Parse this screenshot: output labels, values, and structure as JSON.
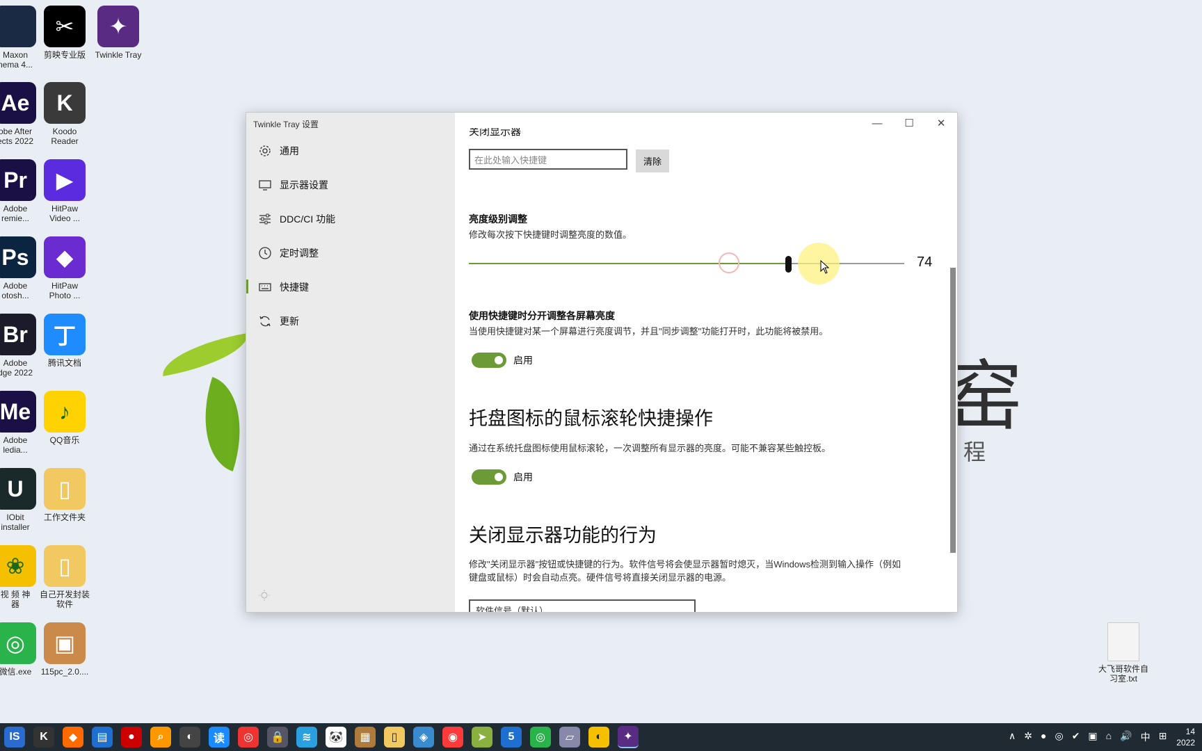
{
  "desktop": {
    "icons": [
      {
        "label": "Maxon\nnema 4...",
        "glyph": "",
        "color": "#1b2a44"
      },
      {
        "label": "剪映专业版",
        "glyph": "✂",
        "color": "#000000"
      },
      {
        "label": "Twinkle Tray",
        "glyph": "✦",
        "color": "#5a2b83"
      },
      {
        "label": "obe After\nects 2022",
        "glyph": "Ae",
        "color": "#1a1046"
      },
      {
        "label": "Koodo\nReader",
        "glyph": "K",
        "color": "#3a3a3a"
      },
      {
        "label": "Adobe\nremie...",
        "glyph": "Pr",
        "color": "#1a1046"
      },
      {
        "label": "HitPaw\nVideo ...",
        "glyph": "▶",
        "color": "#5b2be0"
      },
      {
        "label": "Adobe\notosh...",
        "glyph": "Ps",
        "color": "#0b2440"
      },
      {
        "label": "HitPaw\nPhoto ...",
        "glyph": "◆",
        "color": "#6a2bd0"
      },
      {
        "label": "Adobe\ndge 2022",
        "glyph": "Br",
        "color": "#1b1b2a"
      },
      {
        "label": "腾讯文档",
        "glyph": "丁",
        "color": "#1e8cff"
      },
      {
        "label": "Adobe\nledia...",
        "glyph": "Me",
        "color": "#1a1046"
      },
      {
        "label": "QQ音乐",
        "glyph": "♪",
        "color": "#ffd200"
      },
      {
        "label": "IObit\ninstaller",
        "glyph": "U",
        "color": "#1a2a2a"
      },
      {
        "label": "工作文件夹",
        "glyph": "▯",
        "color": "#f1c960"
      },
      {
        "label": "视 频 神\n器",
        "glyph": "❀",
        "color": "#f5c000"
      },
      {
        "label": "自己开发封装\n软件",
        "glyph": "▯",
        "color": "#f1c960"
      },
      {
        "label": "微信.exe",
        "glyph": "◎",
        "color": "#2ab34a"
      },
      {
        "label": "115pc_2.0....",
        "glyph": "▣",
        "color": "#c98a4a"
      },
      {
        "label": "大飞哥软件自\n习室.txt",
        "glyph": "",
        "color": "#f4f4f4"
      }
    ],
    "bg_text_1": "窑",
    "bg_text_2": "程"
  },
  "window": {
    "title": "Twinkle Tray 设置",
    "controls": {
      "minimize": "—",
      "maximize": "☐",
      "close": "✕"
    },
    "sidebar": {
      "items": [
        {
          "label": "通用",
          "icon": "gear-icon"
        },
        {
          "label": "显示器设置",
          "icon": "monitor-icon"
        },
        {
          "label": "DDC/CI 功能",
          "icon": "sliders-icon"
        },
        {
          "label": "定时调整",
          "icon": "clock-icon"
        },
        {
          "label": "快捷键",
          "icon": "keyboard-icon"
        },
        {
          "label": "更新",
          "icon": "refresh-icon"
        }
      ],
      "active_index": 4
    },
    "content": {
      "cut_title": "关闭显示器",
      "hotkey_placeholder": "在此处输入快捷键",
      "clear_label": "清除",
      "brightness_title": "亮度级别调整",
      "brightness_desc": "修改每次按下快捷键时调整亮度的数值。",
      "brightness_value": "74",
      "separate_title": "使用快捷键时分开调整各屏幕亮度",
      "separate_desc": "当使用快捷键对某一个屏幕进行亮度调节，并且\"同步调整\"功能打开时，此功能将被禁用。",
      "separate_toggle_label": "启用",
      "tray_title": "托盘图标的鼠标滚轮快捷操作",
      "tray_desc": "通过在系统托盘图标使用鼠标滚轮，一次调整所有显示器的亮度。可能不兼容某些触控板。",
      "tray_toggle_label": "启用",
      "turnoff_title": "关闭显示器功能的行为",
      "turnoff_desc_1": "修改\"关闭显示器\"按钮或快捷键的行为。软件信号将会使显示器暂时熄灭，当Windows检测到输入操作（例如",
      "turnoff_desc_2": "键盘或鼠标）时会自动点亮。硬件信号将直接关闭显示器的电源。",
      "turnoff_select": "软件信号（默认）"
    }
  },
  "taskbar": {
    "icons": [
      "IS",
      "K",
      "◆",
      "▤",
      "●",
      "⌕",
      "◐",
      "读",
      "◎",
      "🔒",
      "≋",
      "🐼",
      "▦",
      "▯",
      "◈",
      "◉",
      "➤",
      "5",
      "◎",
      "▱",
      "◐",
      "✦"
    ],
    "tray": [
      "∧",
      "✲",
      "●",
      "◎",
      "✔",
      "▣",
      "⌂",
      "🔊",
      "中",
      "⊞"
    ],
    "clock_time": "14",
    "clock_date": "2022"
  }
}
